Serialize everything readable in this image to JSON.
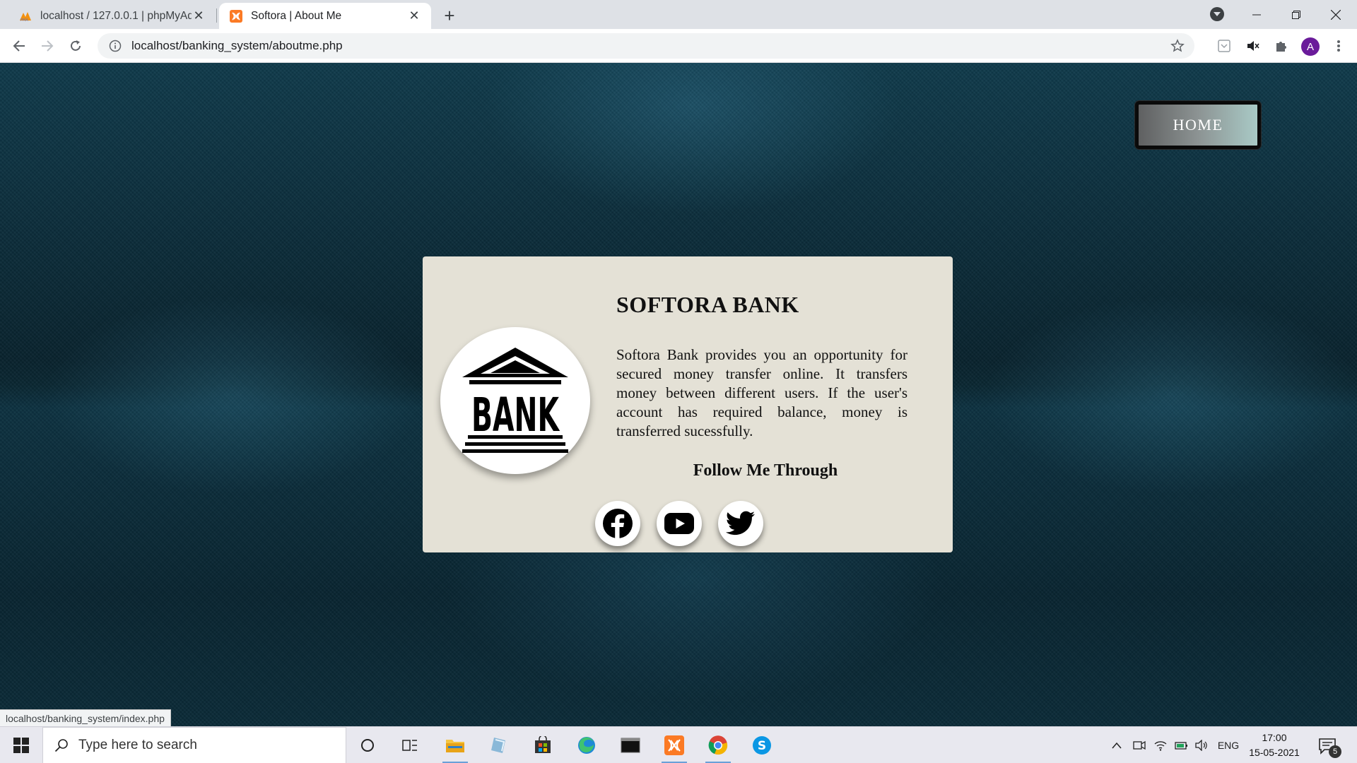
{
  "browser": {
    "tabs": [
      {
        "title": "localhost / 127.0.0.1 | phpMyAdmin",
        "active": false,
        "icon": "phpmyadmin-icon"
      },
      {
        "title": "Softora | About Me",
        "active": true,
        "icon": "xampp-icon"
      }
    ],
    "url": "localhost/banking_system/aboutme.php",
    "profile_initial": "A",
    "status_url": "localhost/banking_system/index.php"
  },
  "nav": {
    "home_label": "HOME"
  },
  "card": {
    "logo_text": "BANK",
    "title": "SOFTORA BANK",
    "description": "Softora Bank provides you an opportunity for secured money transfer online. It transfers money between different users. If the user's account has required balance, money is transferred sucessfully.",
    "follow_label": "Follow Me Through",
    "social": [
      "facebook-icon",
      "youtube-icon",
      "twitter-icon"
    ]
  },
  "taskbar": {
    "search_placeholder": "Type here to search",
    "language": "ENG",
    "time": "17:00",
    "date": "15-05-2021",
    "notification_count": "5"
  },
  "colors": {
    "card_bg": "#e4e1d6",
    "page_bg": "#0b2a36",
    "profile_bg": "#6a1b9a"
  }
}
